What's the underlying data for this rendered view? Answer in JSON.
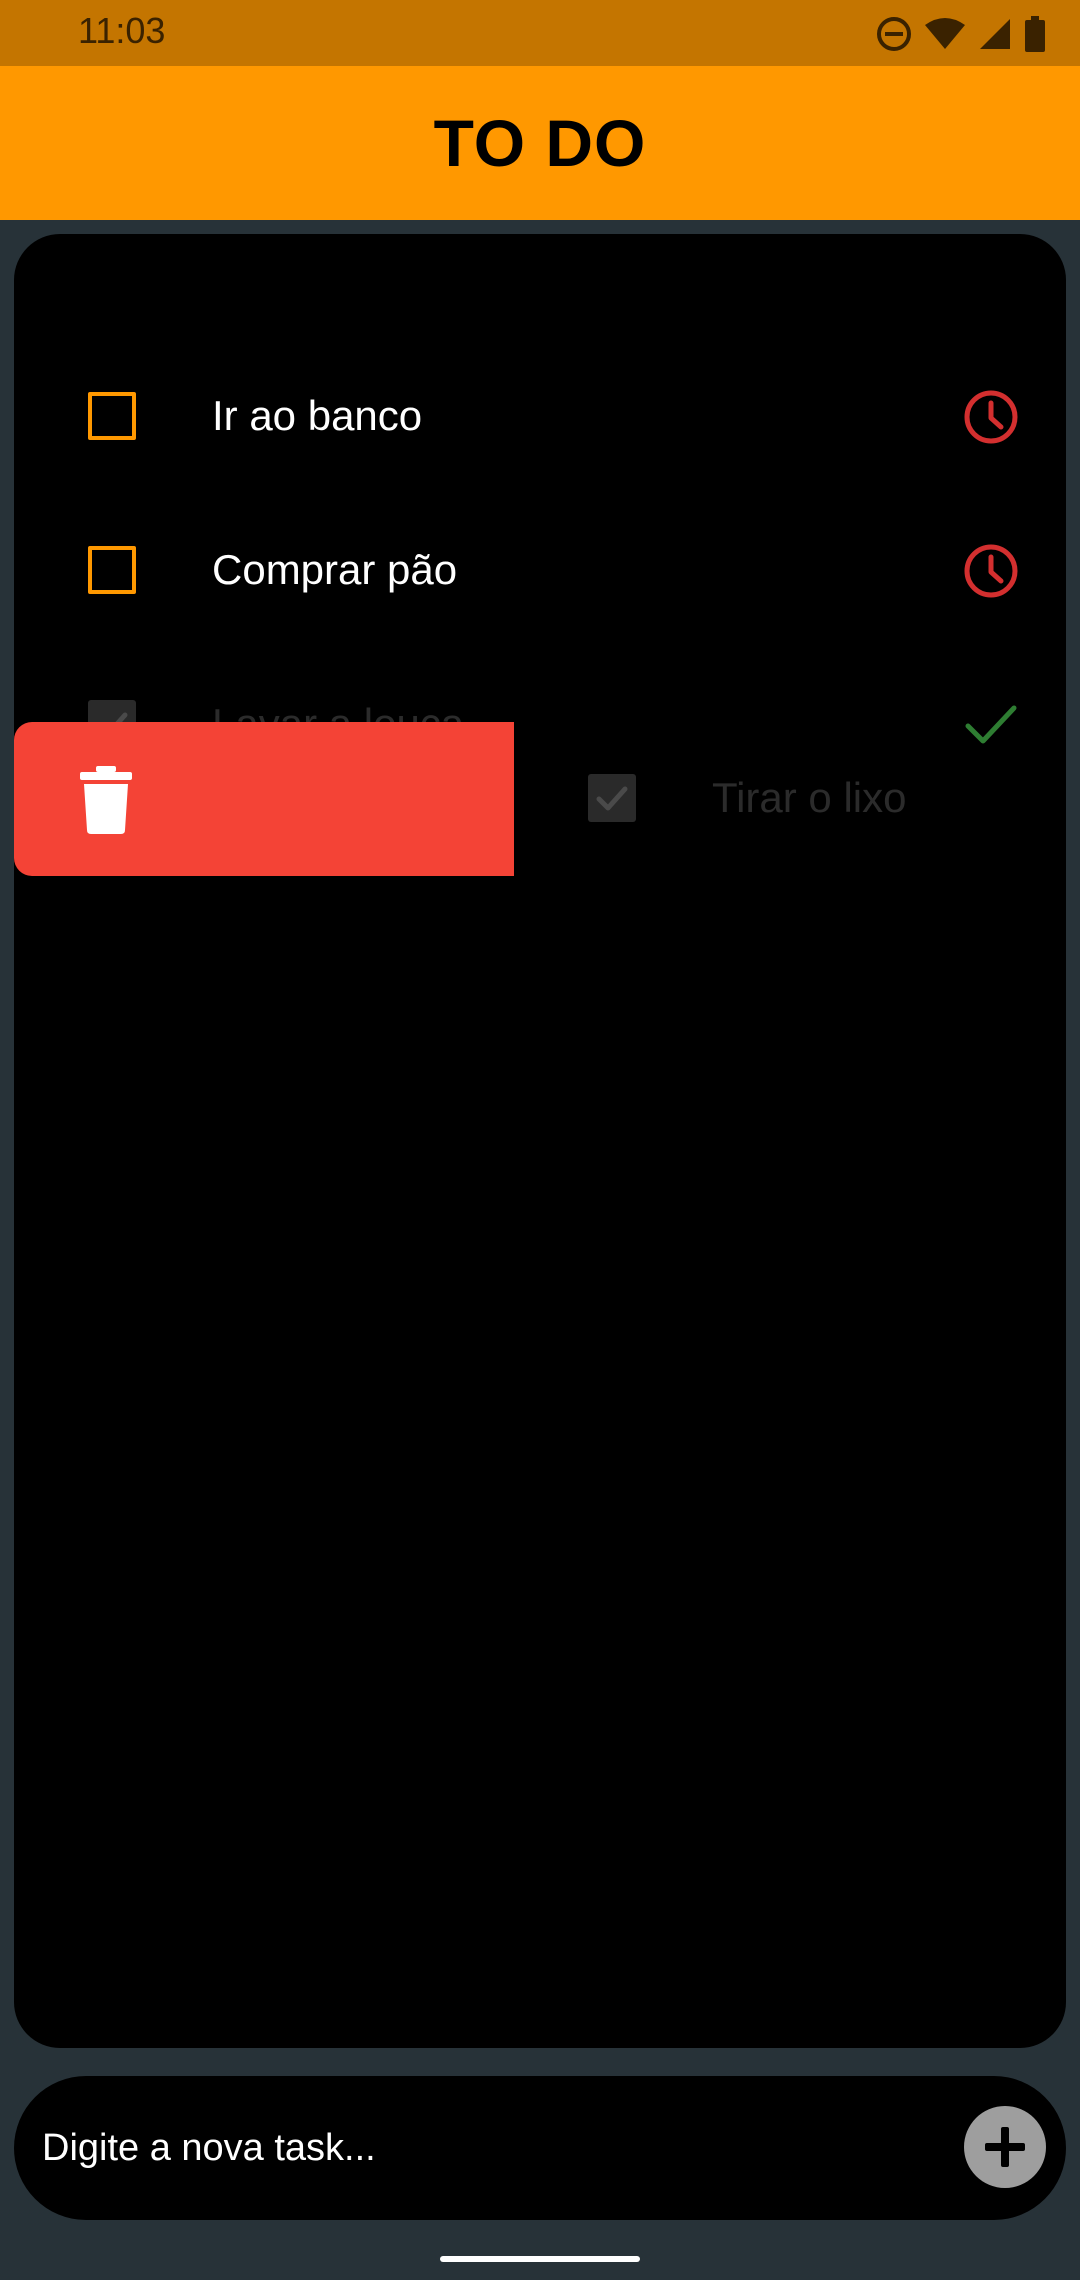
{
  "status_bar": {
    "time": "11:03",
    "icons": [
      "do-not-disturb-icon",
      "wifi-icon",
      "cellular-signal-icon",
      "battery-icon"
    ]
  },
  "app_bar": {
    "title": "TO DO",
    "background": "#ff9800"
  },
  "tasks": [
    {
      "label": "Ir ao banco",
      "done": false,
      "status_icon": "clock-icon"
    },
    {
      "label": "Comprar pão",
      "done": false,
      "status_icon": "clock-icon"
    },
    {
      "label": "Lavar a louça",
      "done": true,
      "status_icon": "check-icon"
    },
    {
      "label": "Tirar o lixo",
      "done": true,
      "status_icon": "check-icon"
    }
  ],
  "swipe_action": {
    "icon": "trash-icon",
    "color": "#f44336"
  },
  "input": {
    "placeholder": "Digite a nova task..."
  },
  "colors": {
    "accent": "#ff9800",
    "pending": "#d32f2f",
    "done": "#2e7d32",
    "background": "#273238",
    "panel": "#000000"
  }
}
